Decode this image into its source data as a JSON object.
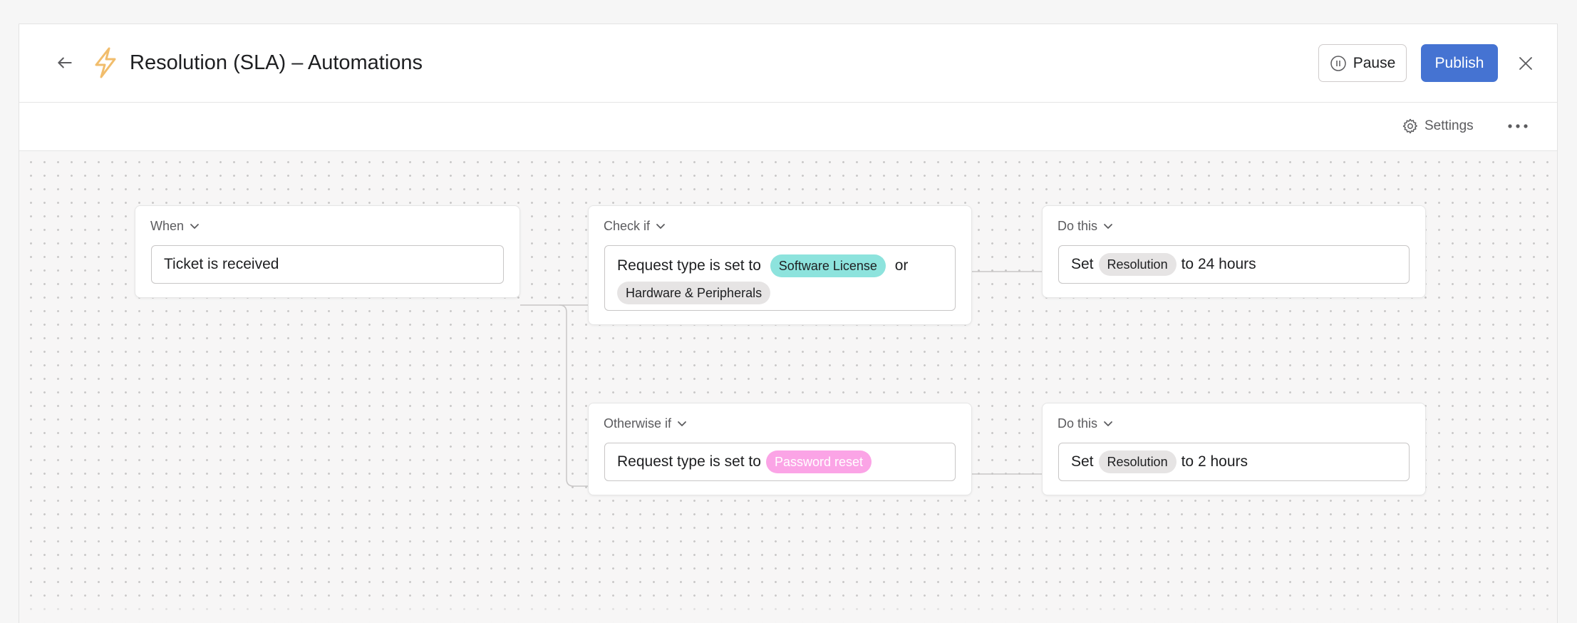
{
  "header": {
    "title": "Resolution (SLA) – Automations",
    "pause_label": "Pause",
    "publish_label": "Publish"
  },
  "toolbar": {
    "settings_label": "Settings"
  },
  "colors": {
    "accent": "#4573d2",
    "bolt": "#f1bd6c",
    "chip_teal": "#8de3dd",
    "chip_pink": "#fba4e6",
    "chip_gray": "#e6e4e4"
  },
  "icons": [
    "arrow-left-icon",
    "lightning-bolt-icon",
    "pause-circle-icon",
    "close-icon",
    "gear-icon",
    "more-horizontal-icon",
    "chevron-down-icon"
  ],
  "workflow": {
    "trigger": {
      "label": "When",
      "value": "Ticket is received"
    },
    "branches": [
      {
        "label": "Check if",
        "condition_prefix": "Request type is set to",
        "condition_values": [
          "Software License",
          "Hardware & Peripherals"
        ],
        "joiner": "or",
        "action": {
          "label": "Do this",
          "verb": "Set",
          "field": "Resolution",
          "value": "to 24 hours"
        }
      },
      {
        "label": "Otherwise if",
        "condition_prefix": "Request type is set to",
        "condition_values": [
          "Password reset"
        ],
        "action": {
          "label": "Do this",
          "verb": "Set",
          "field": "Resolution",
          "value": "to 2 hours"
        }
      }
    ]
  }
}
